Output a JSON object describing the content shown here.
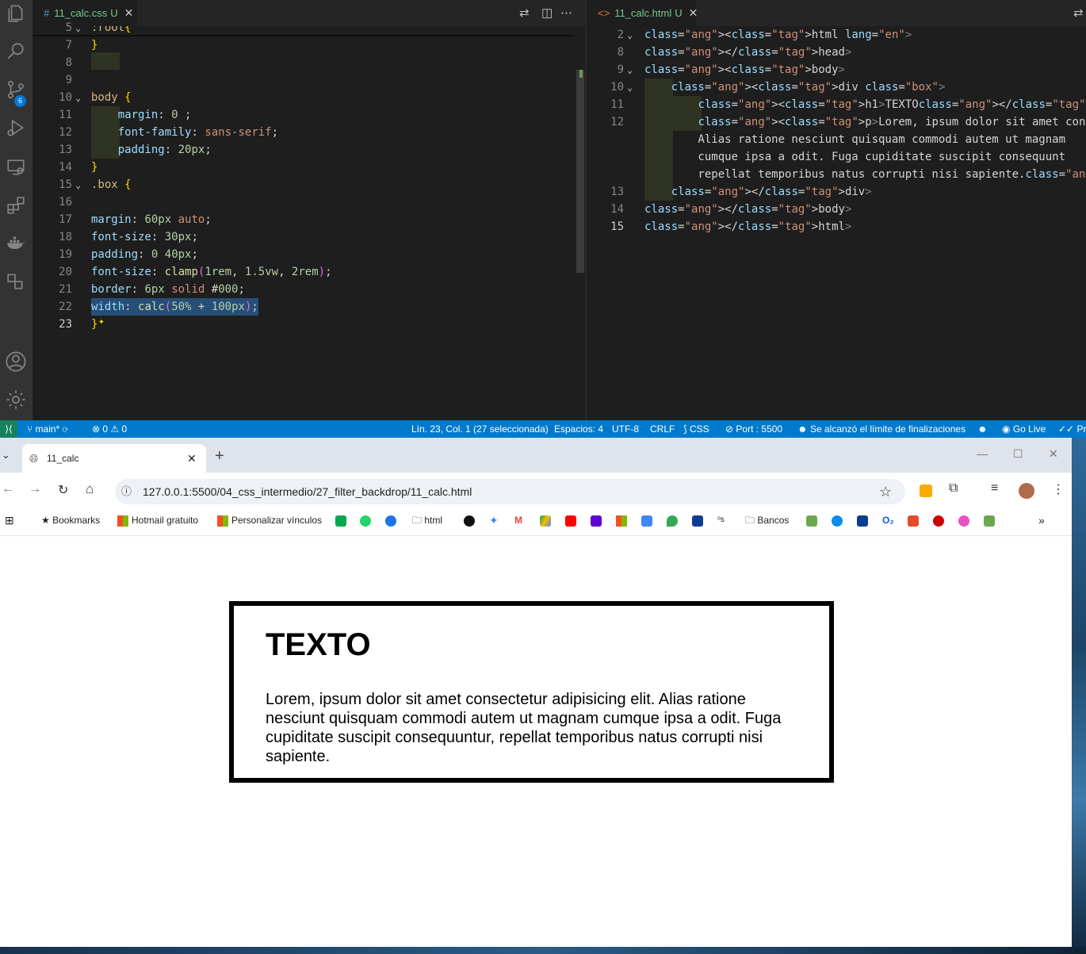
{
  "vscode": {
    "activity_badge": "6",
    "left_tab": {
      "icon": "#",
      "name": "11_calc.css",
      "mod": "U",
      "close": "✕"
    },
    "right_tab": {
      "icon": "<>",
      "name": "11_calc.html",
      "mod": "U",
      "close": "✕"
    },
    "css_lines": [
      {
        "n": "5",
        "code": ":root{"
      },
      {
        "n": "7",
        "code": "}"
      },
      {
        "n": "8",
        "code": ""
      },
      {
        "n": "9",
        "code": ""
      },
      {
        "n": "10",
        "code": "body {"
      },
      {
        "n": "11",
        "code": "    margin: 0 ;"
      },
      {
        "n": "12",
        "code": "    font-family: sans-serif;"
      },
      {
        "n": "13",
        "code": "    padding: 20px;"
      },
      {
        "n": "14",
        "code": "}"
      },
      {
        "n": "15",
        "code": ".box {"
      },
      {
        "n": "16",
        "code": ""
      },
      {
        "n": "17",
        "code": "margin: 60px auto;"
      },
      {
        "n": "18",
        "code": "font-size: 30px;"
      },
      {
        "n": "19",
        "code": "padding: 0 40px;"
      },
      {
        "n": "20",
        "code": "font-size: clamp(1rem, 1.5vw, 2rem);"
      },
      {
        "n": "21",
        "code": "border: 6px solid #000;"
      },
      {
        "n": "22",
        "code": "width: calc(50% + 100px);"
      },
      {
        "n": "23",
        "code": "}"
      }
    ],
    "html_lines": [
      {
        "n": "2",
        "code": "<html lang=\"en\">"
      },
      {
        "n": "8",
        "code": "</head>"
      },
      {
        "n": "9",
        "code": "<body>"
      },
      {
        "n": "10",
        "code": "    <div class=\"box\">"
      },
      {
        "n": "11",
        "code": "        <h1>TEXTO</h1>"
      },
      {
        "n": "12",
        "code": "        <p>Lorem, ipsum dolor sit amet consectetur adipisicing e"
      },
      {
        "n": "",
        "code": "        Alias ratione nesciunt quisquam commodi autem ut magnam"
      },
      {
        "n": "",
        "code": "        cumque ipsa a odit. Fuga cupiditate suscipit consequunt"
      },
      {
        "n": "",
        "code": "        repellat temporibus natus corrupti nisi sapiente.</p>"
      },
      {
        "n": "13",
        "code": "    </div>"
      },
      {
        "n": "14",
        "code": "</body>"
      },
      {
        "n": "15",
        "code": "</html>"
      }
    ]
  },
  "status": {
    "branch": "main*",
    "problems": "⊗ 0 ⚠ 0",
    "position": "Lín. 23, Col. 1 (27 seleccionada)",
    "spaces": "Espacios: 4",
    "encoding": "UTF-8",
    "eol": "CRLF",
    "language": "CSS",
    "port": "Port : 5500",
    "completions": "Se alcanzó el límite de finalizaciones",
    "golive": "Go Live",
    "prettier": "Pre"
  },
  "browser": {
    "tab_title": "11_calc",
    "url": "127.0.0.1:5500/04_css_intermedio/27_filter_backdrop/11_calc.html",
    "bookmarks": [
      "Bookmarks",
      "Hotmail gratuito",
      "Personalizar vínculos",
      "html",
      "Bancos"
    ]
  },
  "page": {
    "heading": "TEXTO",
    "paragraph": "Lorem, ipsum dolor sit amet consectetur adipisicing elit. Alias ratione nesciunt quisquam commodi autem ut magnam cumque ipsa a odit. Fuga cupiditate suscipit consequuntur, repellat temporibus natus corrupti nisi sapiente."
  },
  "icons": [
    "explorer-icon",
    "search-icon",
    "source-control-icon",
    "run-debug-icon",
    "remote-explorer-icon",
    "extensions-icon",
    "docker-icon",
    "accounts-icon",
    "settings-icon"
  ]
}
